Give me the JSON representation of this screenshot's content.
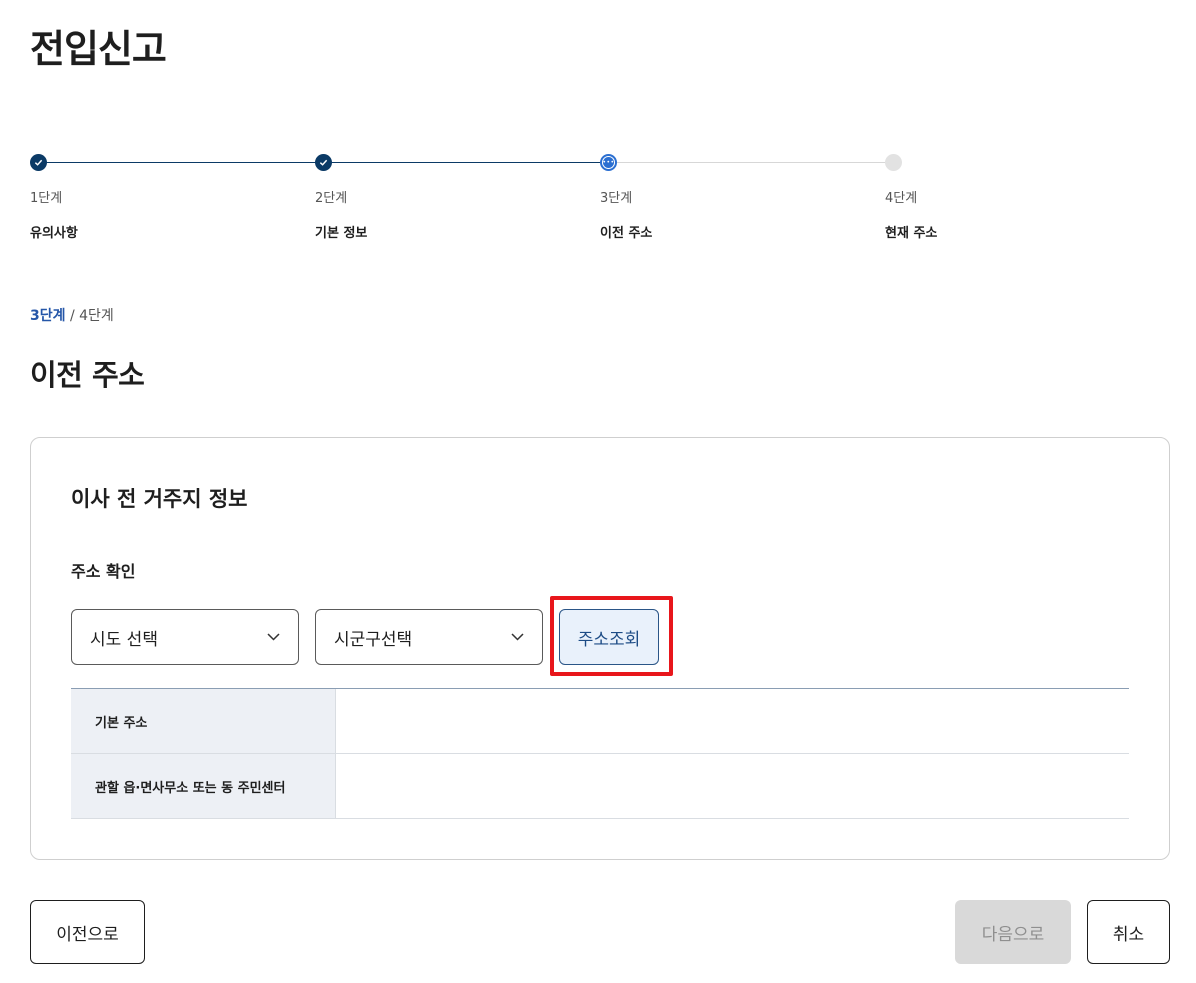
{
  "page": {
    "title": "전입신고"
  },
  "stepper": {
    "steps": [
      {
        "num": "1단계",
        "name": "유의사항",
        "state": "done"
      },
      {
        "num": "2단계",
        "name": "기본 정보",
        "state": "done"
      },
      {
        "num": "3단계",
        "name": "이전 주소",
        "state": "current"
      },
      {
        "num": "4단계",
        "name": "현재 주소",
        "state": "todo"
      }
    ]
  },
  "progress": {
    "current": "3단계",
    "separator": " / ",
    "total": "4단계"
  },
  "section": {
    "title": "이전 주소"
  },
  "card": {
    "title": "이사 전 거주지 정보",
    "field_label": "주소 확인",
    "select_sido": "시도 선택",
    "select_sigungu": "시군구선택",
    "search_button": "주소조회",
    "rows": [
      {
        "label": "기본 주소",
        "value": ""
      },
      {
        "label": "관할 읍·면사무소 또는 동 주민센터",
        "value": ""
      }
    ]
  },
  "actions": {
    "prev": "이전으로",
    "next": "다음으로",
    "cancel": "취소"
  },
  "colors": {
    "accent": "#0b3a66",
    "current_step": "#2b6fd1",
    "highlight": "#e8161b"
  }
}
